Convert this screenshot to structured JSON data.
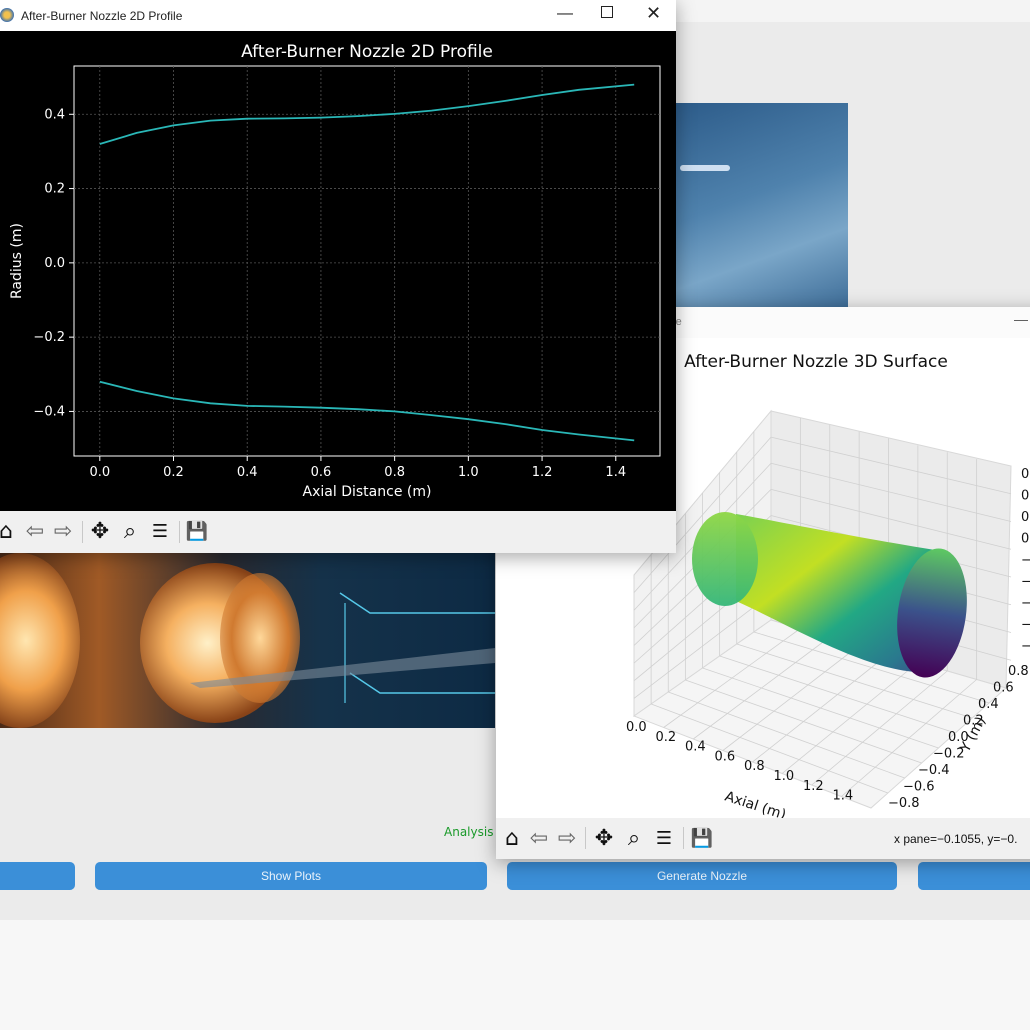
{
  "background_app": {
    "status_text": "Analysis",
    "buttons": [
      {
        "label": ""
      },
      {
        "label": "Show Plots"
      },
      {
        "label": "Generate Nozzle"
      },
      {
        "label": ""
      }
    ]
  },
  "window_2d": {
    "title": "After-Burner Nozzle 2D Profile",
    "controls": [
      "minimize",
      "maximize",
      "close"
    ],
    "toolbar": [
      "home-icon",
      "back-icon",
      "forward-icon",
      "pan-icon",
      "zoom-icon",
      "configure-subplots-icon",
      "save-icon"
    ]
  },
  "window_3d": {
    "title_partial": "ace",
    "status_readout": "x pane=−0.1055, y=−0.",
    "toolbar": [
      "home-icon",
      "back-icon",
      "forward-icon",
      "pan-icon",
      "zoom-icon",
      "configure-subplots-icon",
      "save-icon"
    ]
  },
  "chart_data": [
    {
      "type": "line",
      "title": "After-Burner Nozzle 2D Profile",
      "xlabel": "Axial Distance (m)",
      "ylabel": "Radius (m)",
      "xlim": [
        -0.07,
        1.52
      ],
      "ylim": [
        -0.52,
        0.53
      ],
      "xticks": [
        "0.0",
        "0.2",
        "0.4",
        "0.6",
        "0.8",
        "1.0",
        "1.2",
        "1.4"
      ],
      "yticks": [
        "−0.4",
        "−0.2",
        "0.0",
        "0.2",
        "0.4"
      ],
      "grid": true,
      "background": "#000000",
      "line_color": "#2ab7b7",
      "series": [
        {
          "x": [
            0.0,
            0.1,
            0.2,
            0.3,
            0.4,
            0.5,
            0.6,
            0.7,
            0.8,
            0.9,
            1.0,
            1.1,
            1.2,
            1.3,
            1.45
          ],
          "y": [
            0.32,
            0.35,
            0.37,
            0.383,
            0.388,
            0.389,
            0.391,
            0.395,
            0.401,
            0.41,
            0.422,
            0.436,
            0.452,
            0.466,
            0.48
          ]
        },
        {
          "x": [
            0.0,
            0.1,
            0.2,
            0.3,
            0.4,
            0.5,
            0.6,
            0.7,
            0.8,
            0.9,
            1.0,
            1.1,
            1.2,
            1.3,
            1.45
          ],
          "y": [
            -0.32,
            -0.345,
            -0.365,
            -0.378,
            -0.385,
            -0.387,
            -0.39,
            -0.394,
            -0.4,
            -0.41,
            -0.421,
            -0.434,
            -0.45,
            -0.462,
            -0.478
          ]
        }
      ]
    },
    {
      "type": "surface3d",
      "title": "After-Burner Nozzle 3D Surface",
      "xlabel": "Axial (m)",
      "ylabel": "Y (m)",
      "xticks": [
        "0.0",
        "0.2",
        "0.4",
        "0.6",
        "0.8",
        "1.0",
        "1.2",
        "1.4"
      ],
      "yticks": [
        "0.8",
        "0.6",
        "0.4",
        "0.2",
        "0.0",
        "−0.2",
        "−0.4",
        "−0.6",
        "−0.8"
      ],
      "colormap": "viridis"
    }
  ]
}
